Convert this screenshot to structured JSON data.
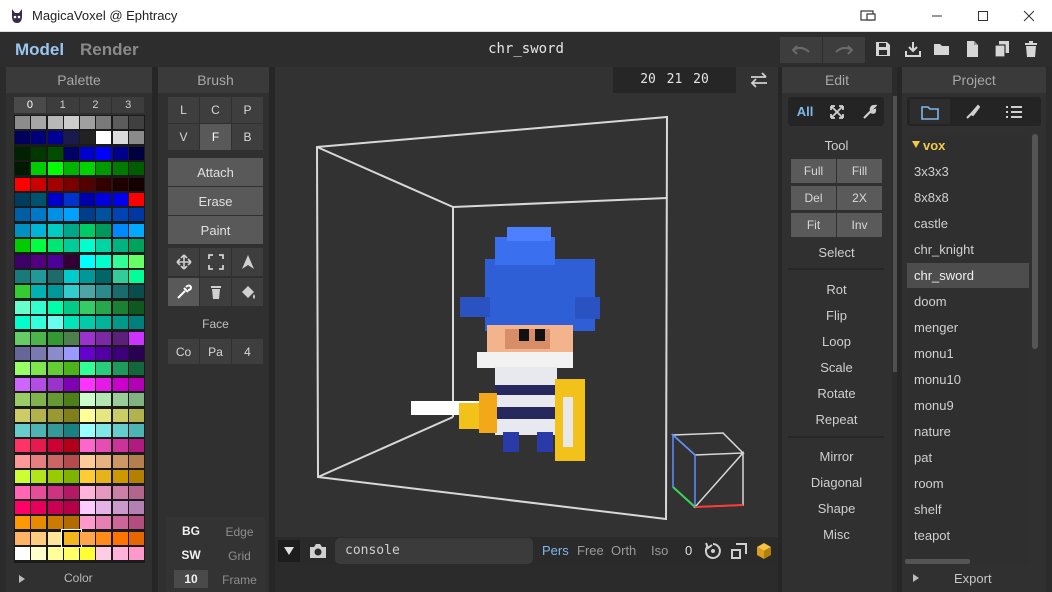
{
  "window": {
    "title": "MagicaVoxel @ Ephtracy"
  },
  "appbar": {
    "mode_model": "Model",
    "mode_render": "Render",
    "filename": "chr_sword"
  },
  "palette": {
    "header": "Palette",
    "tabs": [
      "0",
      "1",
      "2",
      "3"
    ],
    "footer": "Color",
    "selected_color": "#f2b51c",
    "rows": [
      [
        "#8c8c8c",
        "#a6a6a6",
        "#b8b8b8",
        "#cccccc",
        "#a0a0a0",
        "#7a7a7a",
        "#5c5c5c",
        "#404040"
      ],
      [
        "#00005c",
        "#00007a",
        "#000096",
        "#1a1a4d",
        "#222222",
        "#ffffff",
        "#dcdcdc",
        "#8a8a8a"
      ],
      [
        "#002200",
        "#003800",
        "#004d00",
        "#000066",
        "#0000cc",
        "#0000ff",
        "#00008a",
        "#000040"
      ],
      [
        "#001a00",
        "#00cc00",
        "#00ff00",
        "#00b300",
        "#00d400",
        "#009900",
        "#007a00",
        "#005c00"
      ],
      [
        "#ff0000",
        "#cc0000",
        "#a30000",
        "#7a0000",
        "#520000",
        "#330000",
        "#1f0000",
        "#140000"
      ],
      [
        "#003d5c",
        "#00526e",
        "#0000cc",
        "#0033cc",
        "#0000aa",
        "#0000dd",
        "#0000ee",
        "#ff0000"
      ],
      [
        "#005fa3",
        "#0078c8",
        "#0090e6",
        "#00a0ff",
        "#003d8a",
        "#00529e",
        "#0044b3",
        "#0037a3"
      ],
      [
        "#0091c2",
        "#00b5d6",
        "#00ccc2",
        "#00a88a",
        "#00cc66",
        "#00995c",
        "#0088ff",
        "#00aaff"
      ],
      [
        "#00cc00",
        "#00ff40",
        "#00e673",
        "#00cc99",
        "#00ffcc",
        "#00d6a3",
        "#00b380",
        "#00a35c"
      ],
      [
        "#3d0066",
        "#520080",
        "#4d0099",
        "#330033",
        "#00ffff",
        "#00ffcc",
        "#33ff99",
        "#66ff66"
      ],
      [
        "#1a7a7a",
        "#229999",
        "#1f6b6b",
        "#00cccc",
        "#009999",
        "#006666",
        "#33cc99",
        "#00ff99"
      ],
      [
        "#33cc33",
        "#00b3b3",
        "#009999",
        "#33cccc",
        "#4da6a6",
        "#2d8a8a",
        "#1a6b6b",
        "#0a4d4d"
      ],
      [
        "#66ffcc",
        "#33ffcc",
        "#00ffaa",
        "#00cc88",
        "#33cc66",
        "#26a64d",
        "#1a8033",
        "#0d5920"
      ],
      [
        "#00ffcc",
        "#33ffdd",
        "#66ffee",
        "#00e6b8",
        "#00ccaa",
        "#00b399",
        "#00998a",
        "#00807a"
      ],
      [
        "#66cc66",
        "#4db34d",
        "#339933",
        "#4d804d",
        "#9933cc",
        "#7a29a3",
        "#5c1f7a",
        "#cc33ff"
      ],
      [
        "#666699",
        "#7a7ab3",
        "#8a8acc",
        "#9999ff",
        "#6600cc",
        "#5200a3",
        "#3d007a",
        "#290052"
      ],
      [
        "#99ff66",
        "#80e64d",
        "#66cc33",
        "#4db31a",
        "#33ff99",
        "#29cc7a",
        "#1f995c",
        "#14663d"
      ],
      [
        "#cc66ff",
        "#b34de6",
        "#9933cc",
        "#8000b3",
        "#ff33ff",
        "#e61ae6",
        "#cc00cc",
        "#b300b3"
      ],
      [
        "#99cc66",
        "#80b34d",
        "#669933",
        "#4d801a",
        "#ccffcc",
        "#b3e6b3",
        "#99cc99",
        "#80b380"
      ],
      [
        "#cccc66",
        "#b3b34d",
        "#999933",
        "#80801a",
        "#ffff99",
        "#e6e680",
        "#cccc66",
        "#b3b34d"
      ],
      [
        "#66cccc",
        "#4db3b3",
        "#339999",
        "#1a8080",
        "#99ffff",
        "#80e6e6",
        "#66cccc",
        "#4db3b3"
      ],
      [
        "#ff3366",
        "#e61a4d",
        "#cc0033",
        "#b3001a",
        "#ff66cc",
        "#e64db3",
        "#cc3399",
        "#b31a80"
      ],
      [
        "#ff9999",
        "#e68080",
        "#cc6666",
        "#b34d4d",
        "#ffcc99",
        "#e6b380",
        "#cc9966",
        "#b3804d"
      ],
      [
        "#ccff33",
        "#b3e61a",
        "#99cc00",
        "#80b300",
        "#ffcc33",
        "#e6b31a",
        "#cc9900",
        "#b38000"
      ],
      [
        "#ff66b3",
        "#e64d99",
        "#cc3380",
        "#b31a66",
        "#ffb3d9",
        "#e699bf",
        "#cc80a6",
        "#b3668c"
      ],
      [
        "#ff0066",
        "#e6005c",
        "#cc0052",
        "#b30047",
        "#ffccff",
        "#e6b3e6",
        "#cc99cc",
        "#b380b3"
      ],
      [
        "#ff9900",
        "#e68a00",
        "#cc7a00",
        "#b36b00",
        "#ff99cc",
        "#e680b3",
        "#cc6699",
        "#b34d80"
      ],
      [
        "#ffb366",
        "#ffcc80",
        "#ffe699",
        "#f2b51c",
        "#ffa64d",
        "#ff8c1a",
        "#ff7300",
        "#e66600"
      ],
      [
        "#ffffff",
        "#ffffcc",
        "#ffff99",
        "#ffff66",
        "#ffff33",
        "#ffcce6",
        "#ffb3d9",
        "#ff99cc"
      ]
    ]
  },
  "brush": {
    "header": "Brush",
    "shape_row1": [
      "L",
      "C",
      "P"
    ],
    "shape_row2": [
      "V",
      "F",
      "B"
    ],
    "modes": [
      "Attach",
      "Erase",
      "Paint"
    ],
    "face_label": "Face",
    "face_buttons": [
      "Co",
      "Pa",
      "4"
    ],
    "bottom": [
      {
        "value": "BG",
        "label": "Edge"
      },
      {
        "value": "SW",
        "label": "Grid"
      },
      {
        "value": "10",
        "label": "Frame"
      }
    ]
  },
  "viewport": {
    "coords": "20 21 20",
    "console_text": "console",
    "projections": [
      "Pers",
      "Free",
      "Orth",
      "Iso"
    ],
    "active_projection": "Pers",
    "zoom_value": "0"
  },
  "edit": {
    "header": "Edit",
    "filter_label": "All",
    "tool_label": "Tool",
    "tool_buttons": [
      "Full",
      "Fill",
      "Del",
      "2X",
      "Fit",
      "Inv"
    ],
    "select_label": "Select",
    "actions": [
      "Rot",
      "Flip",
      "Loop",
      "Scale",
      "Rotate",
      "Repeat"
    ],
    "actions2": [
      "Mirror",
      "Diagonal",
      "Shape",
      "Misc"
    ]
  },
  "project": {
    "header": "Project",
    "folder": "vox",
    "items": [
      "3x3x3",
      "8x8x8",
      "castle",
      "chr_knight",
      "chr_sword",
      "doom",
      "menger",
      "monu1",
      "monu10",
      "monu9",
      "nature",
      "pat",
      "room",
      "shelf",
      "teapot"
    ],
    "selected": "chr_sword",
    "export_label": "Export"
  },
  "colors": {
    "accent": "#7fb7ea",
    "folder": "#f2c94c",
    "panel": "#303030",
    "button": "#595959"
  }
}
